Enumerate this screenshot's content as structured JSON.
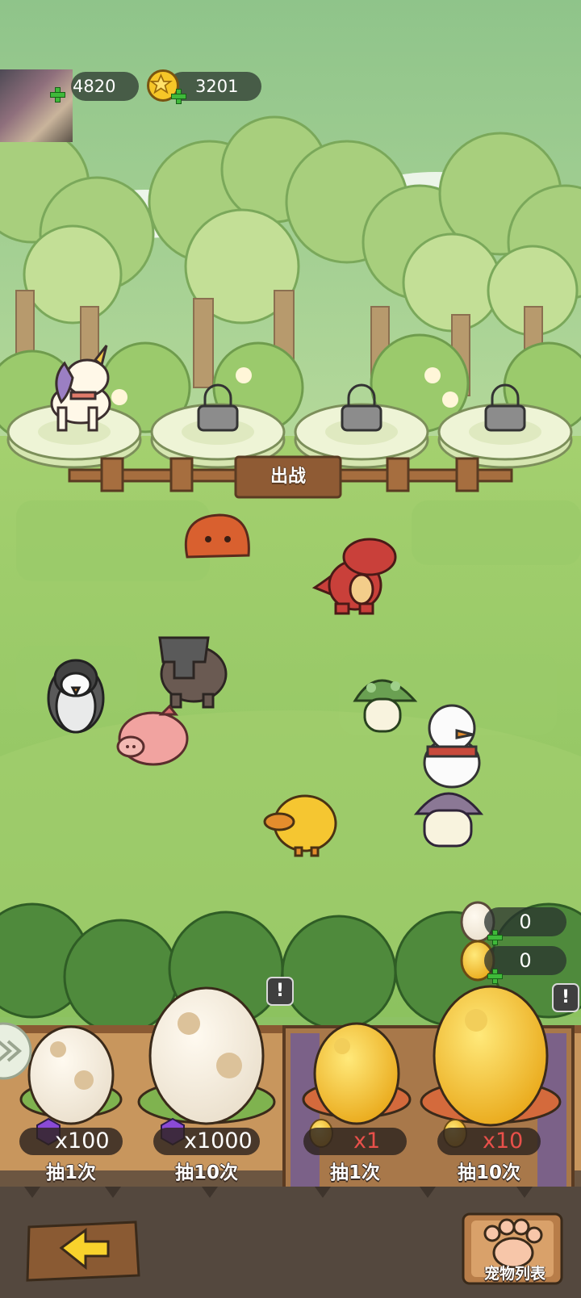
{
  "header": {
    "gems_value": "4820",
    "coins_value": "3201"
  },
  "battle": {
    "fight_label": "出战",
    "slots": [
      {
        "state": "unicorn-pet",
        "locked": false
      },
      {
        "state": "locked",
        "locked": true
      },
      {
        "state": "locked",
        "locked": true
      },
      {
        "state": "locked",
        "locked": true
      }
    ]
  },
  "pets": [
    "slime",
    "red-dinosaur",
    "penguin",
    "crab-claw-elephant",
    "pig",
    "green-mushroom",
    "snowman",
    "yellow-chick",
    "purple-mushroom"
  ],
  "egg_counters": [
    {
      "icon": "white-egg-icon",
      "value": "0"
    },
    {
      "icon": "golden-egg-icon",
      "value": "0"
    }
  ],
  "gacha": [
    {
      "cost": "x100",
      "cost_icon": "purple-gem-icon",
      "draw": "抽1次",
      "cost_color": "#ffffff"
    },
    {
      "cost": "x1000",
      "cost_icon": "purple-gem-icon",
      "draw": "抽10次",
      "cost_color": "#ffffff"
    },
    {
      "cost": "x1",
      "cost_icon": "golden-egg-icon",
      "draw": "抽1次",
      "cost_color": "#e8504a"
    },
    {
      "cost": "x10",
      "cost_icon": "golden-egg-icon",
      "draw": "抽10次",
      "cost_color": "#e8504a"
    }
  ],
  "notices": [
    "!",
    "!"
  ],
  "footer": {
    "pet_list_label": "宠物列表"
  },
  "colors": {
    "grass": "#8dc265",
    "sky": "#9ecf8a",
    "wood": "#8a5a33",
    "golden_egg": "#f2c22c",
    "red_cost": "#e8504a"
  }
}
